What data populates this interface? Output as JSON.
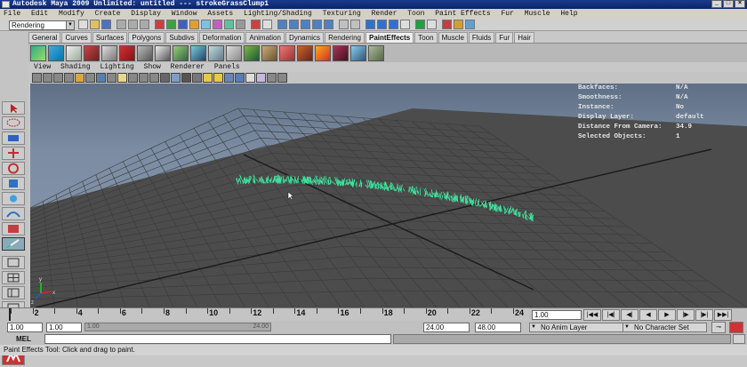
{
  "window": {
    "title": "Autodesk Maya 2009 Unlimited: untitled   ---   strokeGrassClump1",
    "buttons": [
      "_",
      "□",
      "×"
    ]
  },
  "menubar": [
    "File",
    "Edit",
    "Modify",
    "Create",
    "Display",
    "Window",
    "Assets",
    "Lighting/Shading",
    "Texturing",
    "Render",
    "Toon",
    "Paint Effects",
    "Fur",
    "Muscle",
    "Help"
  ],
  "status_line": {
    "mode": "Rendering"
  },
  "shelf_tabs": [
    {
      "label": "General",
      "active": false
    },
    {
      "label": "Curves",
      "active": false
    },
    {
      "label": "Surfaces",
      "active": false
    },
    {
      "label": "Polygons",
      "active": false
    },
    {
      "label": "Subdivs",
      "active": false
    },
    {
      "label": "Deformation",
      "active": false
    },
    {
      "label": "Animation",
      "active": false
    },
    {
      "label": "Dynamics",
      "active": false
    },
    {
      "label": "Rendering",
      "active": false
    },
    {
      "label": "PaintEffects",
      "active": true
    },
    {
      "label": "Toon",
      "active": false
    },
    {
      "label": "Muscle",
      "active": false
    },
    {
      "label": "Fluids",
      "active": false
    },
    {
      "label": "Fur",
      "active": false
    },
    {
      "label": "Hair",
      "active": false
    }
  ],
  "viewport_menu": [
    "View",
    "Shading",
    "Lighting",
    "Show",
    "Renderer",
    "Panels"
  ],
  "hud": [
    {
      "key": "Backfaces:",
      "value": "N/A"
    },
    {
      "key": "Smoothness:",
      "value": "N/A"
    },
    {
      "key": "Instance:",
      "value": "No"
    },
    {
      "key": "Display Layer:",
      "value": "default"
    },
    {
      "key": "Distance From Camera:",
      "value": "34.9"
    },
    {
      "key": "Selected Objects:",
      "value": "1"
    }
  ],
  "viewport": {
    "stroke_color": "#3ee6a0",
    "grid_color": "#3a3a3a"
  },
  "time_slider": {
    "ticks": [
      "2",
      "4",
      "6",
      "8",
      "10",
      "12",
      "14",
      "16",
      "18",
      "20",
      "22",
      "24"
    ],
    "current_frame": "1.00"
  },
  "range_slider": {
    "start": "1.00",
    "inner_start": "1.00",
    "inner_end": "24.00",
    "range_end": "24.00",
    "end": "48.00",
    "anim_layer": "No Anim Layer",
    "character_set": "No Character Set"
  },
  "command_line": {
    "label": "MEL"
  },
  "help_line": "Paint Effects Tool: Click and drag to paint."
}
